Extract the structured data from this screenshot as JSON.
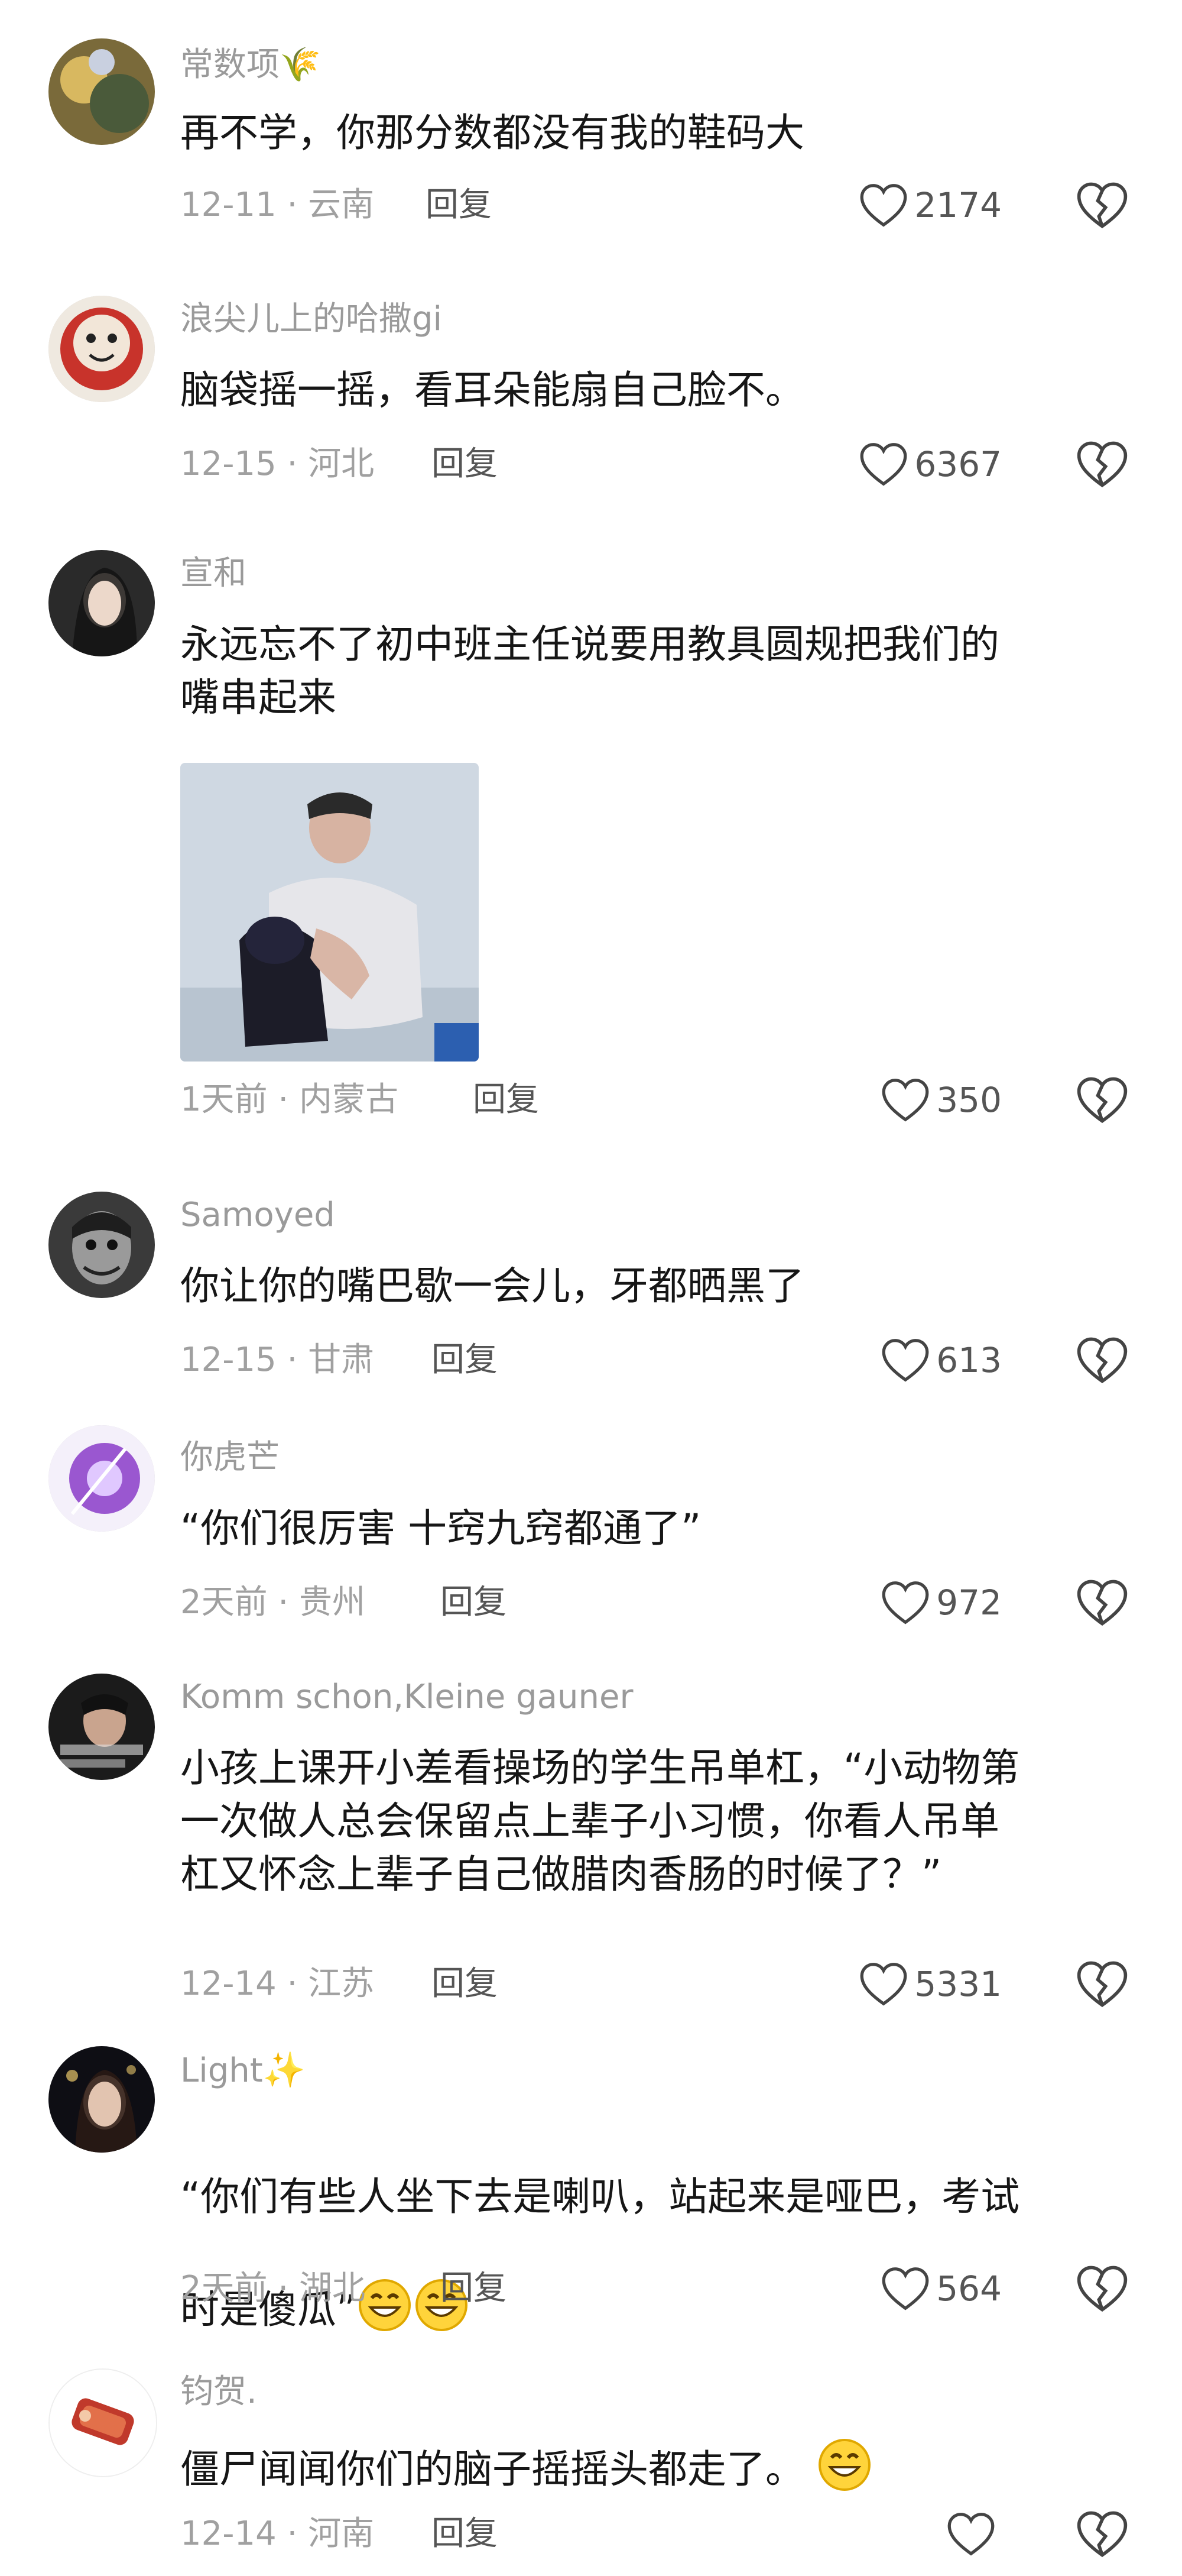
{
  "comments": [
    {
      "username": "常数项🌾",
      "text": "再不学，你那分数都没有我的鞋码大",
      "meta": "12-11 · 云南",
      "reply": "回复",
      "likes": "2174"
    },
    {
      "username": "浪尖儿上的哈撒gi",
      "text": "脑袋摇一摇，看耳朵能扇自己脸不。",
      "meta": "12-15 · 河北",
      "reply": "回复",
      "likes": "6367"
    },
    {
      "username": "宣和",
      "text": "永远忘不了初中班主任说要用教具圆规把我们的\n嘴串起来",
      "meta": "1天前 · 内蒙古",
      "reply": "回复",
      "likes": "350"
    },
    {
      "username": "Samoyed",
      "text": "你让你的嘴巴歇一会儿，牙都晒黑了",
      "meta": "12-15 · 甘肃",
      "reply": "回复",
      "likes": "613"
    },
    {
      "username": "你虎芒",
      "text": "“你们很厉害 十窍九窍都通了”",
      "meta": "2天前 · 贵州",
      "reply": "回复",
      "likes": "972"
    },
    {
      "username": "Komm schon,Kleine gauner",
      "text": "小孩上课开小差看操场的学生吊单杠，“小动物第\n一次做人总会保留点上辈子小习惯，你看人吊单\n杠又怀念上辈子自己做腊肉香肠的时候了？”",
      "meta": "12-14 · 江苏",
      "reply": "回复",
      "likes": "5331"
    },
    {
      "username": "Light",
      "username_suffix": "✨",
      "text_line1": "“你们有些人坐下去是喇叭，站起来是哑巴，考试",
      "text_line2": "时是傻瓜”",
      "meta": "2天前 · 湖北",
      "reply": "回复",
      "likes": "564"
    },
    {
      "username": "钧贺.",
      "text": "僵尸闻闻你们的脑子摇摇头都走了。",
      "meta": "12-14 · 河南",
      "reply": "回复",
      "likes": ""
    }
  ],
  "icons": {
    "like": "heart-outline-icon",
    "dislike": "broken-heart-icon",
    "emoji": "grinning-face-icon"
  },
  "colors": {
    "username": "#9a9a9a",
    "text": "#161616",
    "meta": "#a0a0a0"
  }
}
